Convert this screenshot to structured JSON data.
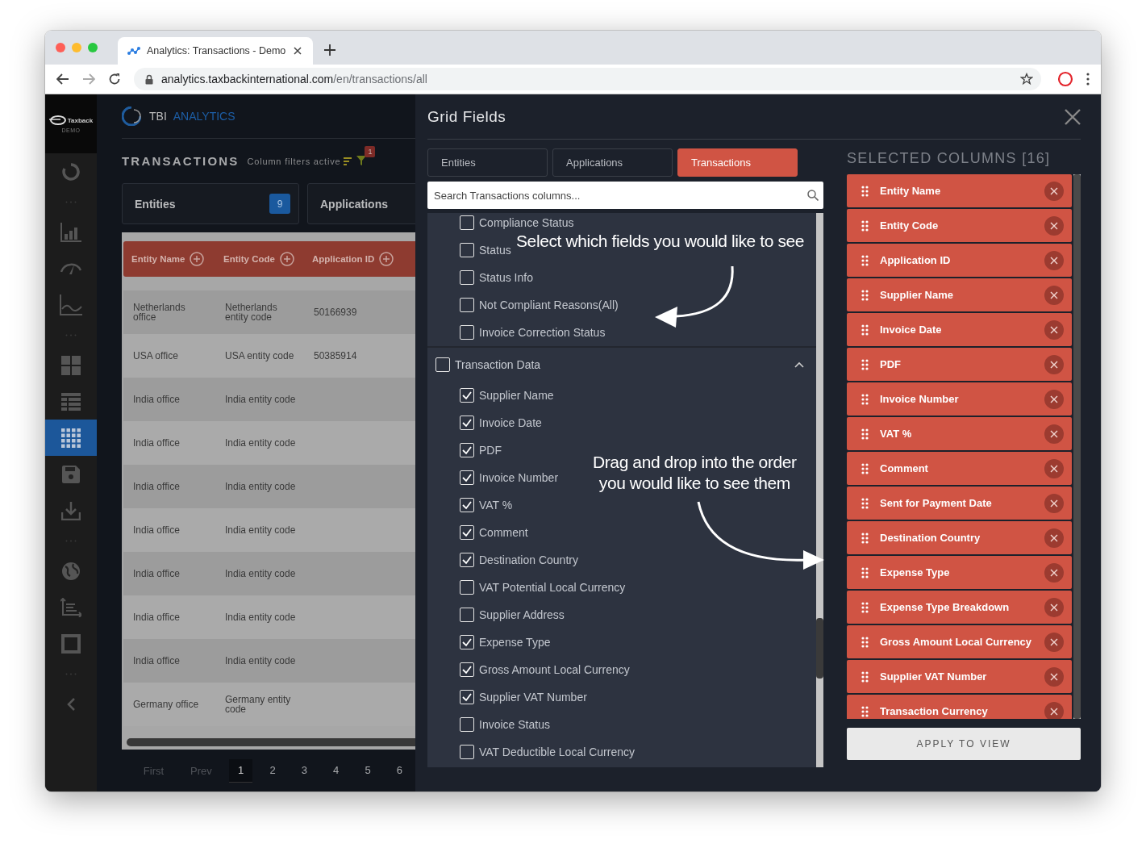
{
  "browser": {
    "tab_title": "Analytics: Transactions - Demo",
    "url_host": "analytics.taxbackinternational.com",
    "url_path": "/en/transactions/all"
  },
  "logo": {
    "name": "Taxback",
    "sub": "DEMO"
  },
  "sidebar": {
    "groups": [
      [
        {
          "kind": "donut",
          "selected": false
        }
      ],
      [
        {
          "kind": "bar-chart",
          "selected": false
        },
        {
          "kind": "gauge",
          "selected": false
        },
        {
          "kind": "line-chart",
          "selected": false
        }
      ],
      [
        {
          "kind": "tiles",
          "selected": false
        },
        {
          "kind": "list",
          "selected": false
        },
        {
          "kind": "grid",
          "selected": true
        },
        {
          "kind": "save",
          "selected": false
        },
        {
          "kind": "download",
          "selected": false
        }
      ],
      [
        {
          "kind": "globe",
          "selected": false
        },
        {
          "kind": "tree",
          "selected": false
        },
        {
          "kind": "square",
          "selected": false
        }
      ],
      [
        {
          "kind": "chevron-left",
          "selected": false
        }
      ]
    ]
  },
  "header": {
    "brand": "TBI",
    "product": "ANALYTICS"
  },
  "page": {
    "title": "TRANSACTIONS",
    "filter_note": "Column filters active",
    "filter_count": "1"
  },
  "summary_cards": [
    {
      "label": "Entities",
      "count": "9"
    },
    {
      "label": "Applications"
    }
  ],
  "table": {
    "columns": [
      "Entity Name",
      "Entity Code",
      "Application ID"
    ],
    "rows": [
      [
        "Netherlands office",
        "Netherlands entity code",
        "50166939"
      ],
      [
        "USA office",
        "USA entity code",
        "50385914"
      ],
      [
        "India office",
        "India entity code"
      ],
      [
        "India office",
        "India entity code"
      ],
      [
        "India office",
        "India entity code"
      ],
      [
        "India office",
        "India entity code"
      ],
      [
        "India office",
        "India entity code"
      ],
      [
        "India office",
        "India entity code"
      ],
      [
        "India office",
        "India entity code"
      ],
      [
        "Germany office",
        "Germany entity code"
      ]
    ]
  },
  "pagination": {
    "first": "First",
    "prev": "Prev",
    "pages": [
      {
        "label": "1",
        "selected": true
      },
      {
        "label": "2",
        "selected": false
      },
      {
        "label": "3",
        "selected": false
      },
      {
        "label": "4",
        "selected": false
      },
      {
        "label": "5",
        "selected": false
      },
      {
        "label": "6",
        "selected": false
      }
    ]
  },
  "dialog": {
    "title": "Grid Fields",
    "tabs": [
      {
        "label": "Entities",
        "selected": false
      },
      {
        "label": "Applications",
        "selected": false
      },
      {
        "label": "Transactions",
        "selected": true
      }
    ],
    "search": {
      "placeholder": "Search Transactions columns..."
    },
    "field_groups": [
      {
        "items": [
          {
            "label": "Compliance Status",
            "checked": false
          },
          {
            "label": "Status",
            "checked": false
          },
          {
            "label": "Status Info",
            "checked": false
          },
          {
            "label": "Not Compliant Reasons(All)",
            "checked": false
          },
          {
            "label": "Invoice Correction Status",
            "checked": false
          }
        ]
      },
      {
        "label": "Transaction Data",
        "checked": false,
        "expanded": true,
        "items": [
          {
            "label": "Supplier Name",
            "checked": true
          },
          {
            "label": "Invoice Date",
            "checked": true
          },
          {
            "label": "PDF",
            "checked": true
          },
          {
            "label": "Invoice Number",
            "checked": true
          },
          {
            "label": "VAT %",
            "checked": true
          },
          {
            "label": "Comment",
            "checked": true
          },
          {
            "label": "Destination Country",
            "checked": true
          },
          {
            "label": "VAT Potential Local Currency",
            "checked": false
          },
          {
            "label": "Supplier Address",
            "checked": false
          },
          {
            "label": "Expense Type",
            "checked": true
          },
          {
            "label": "Gross Amount Local Currency",
            "checked": true
          },
          {
            "label": "Supplier VAT Number",
            "checked": true
          },
          {
            "label": "Invoice Status",
            "checked": false
          },
          {
            "label": "VAT Deductible Local Currency",
            "checked": false
          }
        ]
      }
    ],
    "annotations": [
      {
        "kind": "select",
        "text": "Select which fields you would like to see"
      },
      {
        "kind": "drag",
        "text": "Drag and drop into the order\nyou would like to see them"
      }
    ],
    "selected_title": "SELECTED COLUMNS [16]",
    "selected_columns": [
      "Entity Name",
      "Entity Code",
      "Application ID",
      "Supplier Name",
      "Invoice Date",
      "PDF",
      "Invoice Number",
      "VAT %",
      "Comment",
      "Sent for Payment Date",
      "Destination Country",
      "Expense Type",
      "Expense Type Breakdown",
      "Gross Amount Local Currency",
      "Supplier VAT Number",
      "Transaction Currency"
    ],
    "apply_button": "APPLY TO VIEW"
  }
}
